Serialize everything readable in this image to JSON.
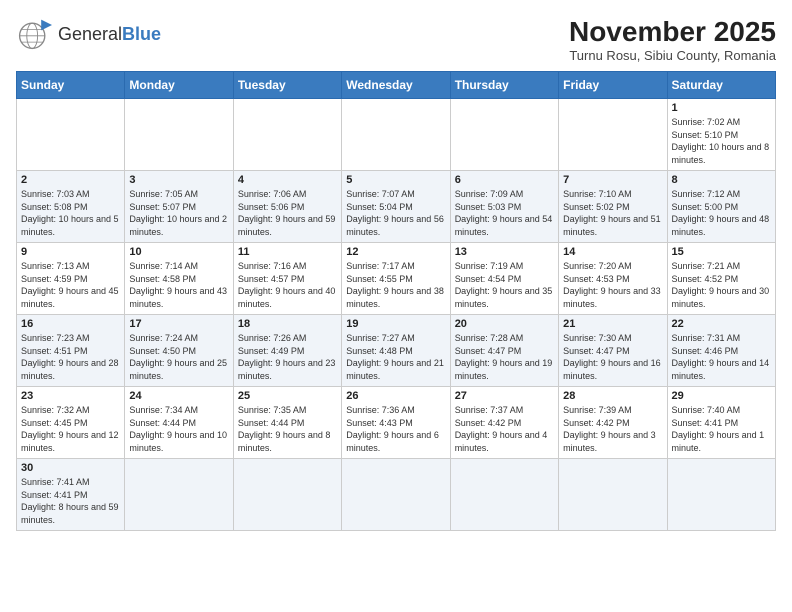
{
  "header": {
    "logo_general": "General",
    "logo_blue": "Blue",
    "month_title": "November 2025",
    "location": "Turnu Rosu, Sibiu County, Romania"
  },
  "days_of_week": [
    "Sunday",
    "Monday",
    "Tuesday",
    "Wednesday",
    "Thursday",
    "Friday",
    "Saturday"
  ],
  "weeks": [
    {
      "days": [
        {
          "num": "",
          "info": ""
        },
        {
          "num": "",
          "info": ""
        },
        {
          "num": "",
          "info": ""
        },
        {
          "num": "",
          "info": ""
        },
        {
          "num": "",
          "info": ""
        },
        {
          "num": "",
          "info": ""
        },
        {
          "num": "1",
          "info": "Sunrise: 7:02 AM\nSunset: 5:10 PM\nDaylight: 10 hours and 8 minutes."
        }
      ]
    },
    {
      "days": [
        {
          "num": "2",
          "info": "Sunrise: 7:03 AM\nSunset: 5:08 PM\nDaylight: 10 hours and 5 minutes."
        },
        {
          "num": "3",
          "info": "Sunrise: 7:05 AM\nSunset: 5:07 PM\nDaylight: 10 hours and 2 minutes."
        },
        {
          "num": "4",
          "info": "Sunrise: 7:06 AM\nSunset: 5:06 PM\nDaylight: 9 hours and 59 minutes."
        },
        {
          "num": "5",
          "info": "Sunrise: 7:07 AM\nSunset: 5:04 PM\nDaylight: 9 hours and 56 minutes."
        },
        {
          "num": "6",
          "info": "Sunrise: 7:09 AM\nSunset: 5:03 PM\nDaylight: 9 hours and 54 minutes."
        },
        {
          "num": "7",
          "info": "Sunrise: 7:10 AM\nSunset: 5:02 PM\nDaylight: 9 hours and 51 minutes."
        },
        {
          "num": "8",
          "info": "Sunrise: 7:12 AM\nSunset: 5:00 PM\nDaylight: 9 hours and 48 minutes."
        }
      ]
    },
    {
      "days": [
        {
          "num": "9",
          "info": "Sunrise: 7:13 AM\nSunset: 4:59 PM\nDaylight: 9 hours and 45 minutes."
        },
        {
          "num": "10",
          "info": "Sunrise: 7:14 AM\nSunset: 4:58 PM\nDaylight: 9 hours and 43 minutes."
        },
        {
          "num": "11",
          "info": "Sunrise: 7:16 AM\nSunset: 4:57 PM\nDaylight: 9 hours and 40 minutes."
        },
        {
          "num": "12",
          "info": "Sunrise: 7:17 AM\nSunset: 4:55 PM\nDaylight: 9 hours and 38 minutes."
        },
        {
          "num": "13",
          "info": "Sunrise: 7:19 AM\nSunset: 4:54 PM\nDaylight: 9 hours and 35 minutes."
        },
        {
          "num": "14",
          "info": "Sunrise: 7:20 AM\nSunset: 4:53 PM\nDaylight: 9 hours and 33 minutes."
        },
        {
          "num": "15",
          "info": "Sunrise: 7:21 AM\nSunset: 4:52 PM\nDaylight: 9 hours and 30 minutes."
        }
      ]
    },
    {
      "days": [
        {
          "num": "16",
          "info": "Sunrise: 7:23 AM\nSunset: 4:51 PM\nDaylight: 9 hours and 28 minutes."
        },
        {
          "num": "17",
          "info": "Sunrise: 7:24 AM\nSunset: 4:50 PM\nDaylight: 9 hours and 25 minutes."
        },
        {
          "num": "18",
          "info": "Sunrise: 7:26 AM\nSunset: 4:49 PM\nDaylight: 9 hours and 23 minutes."
        },
        {
          "num": "19",
          "info": "Sunrise: 7:27 AM\nSunset: 4:48 PM\nDaylight: 9 hours and 21 minutes."
        },
        {
          "num": "20",
          "info": "Sunrise: 7:28 AM\nSunset: 4:47 PM\nDaylight: 9 hours and 19 minutes."
        },
        {
          "num": "21",
          "info": "Sunrise: 7:30 AM\nSunset: 4:47 PM\nDaylight: 9 hours and 16 minutes."
        },
        {
          "num": "22",
          "info": "Sunrise: 7:31 AM\nSunset: 4:46 PM\nDaylight: 9 hours and 14 minutes."
        }
      ]
    },
    {
      "days": [
        {
          "num": "23",
          "info": "Sunrise: 7:32 AM\nSunset: 4:45 PM\nDaylight: 9 hours and 12 minutes."
        },
        {
          "num": "24",
          "info": "Sunrise: 7:34 AM\nSunset: 4:44 PM\nDaylight: 9 hours and 10 minutes."
        },
        {
          "num": "25",
          "info": "Sunrise: 7:35 AM\nSunset: 4:44 PM\nDaylight: 9 hours and 8 minutes."
        },
        {
          "num": "26",
          "info": "Sunrise: 7:36 AM\nSunset: 4:43 PM\nDaylight: 9 hours and 6 minutes."
        },
        {
          "num": "27",
          "info": "Sunrise: 7:37 AM\nSunset: 4:42 PM\nDaylight: 9 hours and 4 minutes."
        },
        {
          "num": "28",
          "info": "Sunrise: 7:39 AM\nSunset: 4:42 PM\nDaylight: 9 hours and 3 minutes."
        },
        {
          "num": "29",
          "info": "Sunrise: 7:40 AM\nSunset: 4:41 PM\nDaylight: 9 hours and 1 minute."
        }
      ]
    },
    {
      "days": [
        {
          "num": "30",
          "info": "Sunrise: 7:41 AM\nSunset: 4:41 PM\nDaylight: 8 hours and 59 minutes."
        },
        {
          "num": "",
          "info": ""
        },
        {
          "num": "",
          "info": ""
        },
        {
          "num": "",
          "info": ""
        },
        {
          "num": "",
          "info": ""
        },
        {
          "num": "",
          "info": ""
        },
        {
          "num": "",
          "info": ""
        }
      ]
    }
  ]
}
